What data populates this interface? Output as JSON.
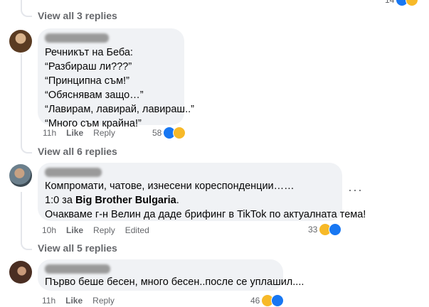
{
  "top": {
    "view_replies_label": "View all 3 replies",
    "partial_count": "14"
  },
  "comments": [
    {
      "lines": [
        "Речникът на Беба:",
        "“Разбираш ли???”",
        "“Принципна съм!”",
        "“Обяснявам защо…”",
        "“Лавирам, лавирай, лавираш..”",
        "“Много съм крайна!”"
      ],
      "time": "11h",
      "like_label": "Like",
      "reply_label": "Reply",
      "reaction_count": "58",
      "reactions": [
        "like-icon",
        "haha-icon"
      ],
      "view_replies_label": "View all 6 replies"
    },
    {
      "author_partial": "А...",
      "line1": "Компромати, чатове, изнесени кореспонденции……",
      "line2_prefix": "1:0 за ",
      "line2_bold": "Big Brother Bulgaria",
      "line2_suffix": ".",
      "line3": "Очакваме г-н Велин да даде брифинг в TikTok по актуалната тема!",
      "time": "10h",
      "like_label": "Like",
      "reply_label": "Reply",
      "edited_label": "Edited",
      "reaction_count": "33",
      "reactions": [
        "haha-icon",
        "like-icon"
      ],
      "more_label": "···",
      "view_replies_label": "View all 5 replies"
    },
    {
      "lines": [
        "Първо беше бесен, много бесен..после се уплашил...."
      ],
      "time": "11h",
      "like_label": "Like",
      "reply_label": "Reply",
      "reaction_count": "46",
      "reactions": [
        "haha-icon",
        "like-icon"
      ]
    }
  ],
  "colors": {
    "bubble": "#f0f2f5",
    "secondary_text": "#65676b",
    "like_blue": "#1877f2",
    "haha_yellow": "#f7b928"
  }
}
